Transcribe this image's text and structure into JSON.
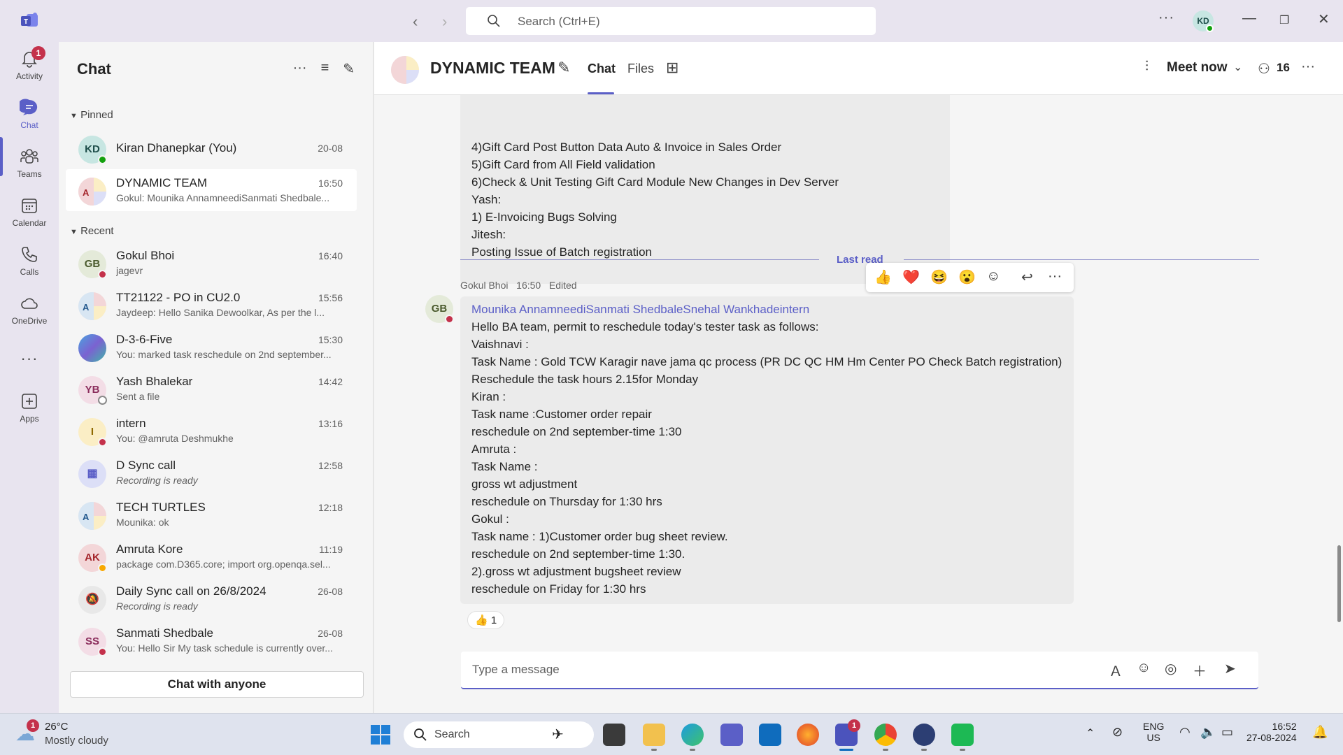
{
  "titlebar": {
    "search_placeholder": "Search (Ctrl+E)",
    "user_initials": "KD"
  },
  "rail": {
    "items": [
      {
        "label": "Activity",
        "badge": "1"
      },
      {
        "label": "Chat"
      },
      {
        "label": "Teams"
      },
      {
        "label": "Calendar"
      },
      {
        "label": "Calls"
      },
      {
        "label": "OneDrive"
      },
      {
        "label": "Apps"
      }
    ]
  },
  "chatlist": {
    "title": "Chat",
    "pinned_label": "Pinned",
    "recent_label": "Recent",
    "chat_with_anyone": "Chat with anyone",
    "pinned": [
      {
        "initials": "KD",
        "name": "Kiran Dhanepkar (You)",
        "time": "20-08",
        "preview": ""
      },
      {
        "initials": "A",
        "name": "DYNAMIC TEAM",
        "time": "16:50",
        "preview": "Gokul: Mounika AnnamneediSanmati Shedbale..."
      }
    ],
    "recent": [
      {
        "initials": "GB",
        "name": "Gokul Bhoi",
        "time": "16:40",
        "preview": "jagevr"
      },
      {
        "initials": "A",
        "name": "TT21122 - PO in CU2.0",
        "time": "15:56",
        "preview": "Jaydeep: Hello Sanika Dewoolkar,   As per the l..."
      },
      {
        "initials": "",
        "name": "D-3-6-Five",
        "time": "15:30",
        "preview": "You: marked task reschedule on 2nd september..."
      },
      {
        "initials": "YB",
        "name": "Yash Bhalekar",
        "time": "14:42",
        "preview": "Sent a file"
      },
      {
        "initials": "I",
        "name": "intern",
        "time": "13:16",
        "preview": "You: @amruta Deshmukhe"
      },
      {
        "initials": "",
        "name": "D Sync call",
        "time": "12:58",
        "preview": "Recording is ready"
      },
      {
        "initials": "A",
        "name": "TECH TURTLES",
        "time": "12:18",
        "preview": "Mounika: ok"
      },
      {
        "initials": "AK",
        "name": "Amruta Kore",
        "time": "11:19",
        "preview": "package com.D365.core; import org.openqa.sel..."
      },
      {
        "initials": "",
        "name": "Daily Sync call on 26/8/2024",
        "time": "26-08",
        "preview": "Recording is ready"
      },
      {
        "initials": "SS",
        "name": "Sanmati Shedbale",
        "time": "26-08",
        "preview": "You: Hello Sir My task schedule is currently over..."
      }
    ]
  },
  "conversation": {
    "title": "DYNAMIC TEAM",
    "tabs": [
      "Chat",
      "Files"
    ],
    "meet_now": "Meet now",
    "participants": "16",
    "prev_message_lines": [
      "4)Gift Card Post Button Data Auto & Invoice in Sales Order",
      "5)Gift Card from All Field validation",
      "6)Check & Unit Testing Gift Card Module New Changes in Dev Server",
      "Yash:",
      "1) E-Invoicing Bugs Solving",
      "Jitesh:",
      "Posting Issue of Batch registration"
    ],
    "last_read": "Last read",
    "message": {
      "sender": "Gokul Bhoi",
      "time": "16:50",
      "edited": "Edited",
      "initials": "GB",
      "mention_line": "Mounika AnnamneediSanmati ShedbaleSnehal Wankhadeintern",
      "lines": [
        "Hello BA team, permit to reschedule today's tester task as follows:",
        "Vaishnavi :",
        "Task Name : Gold TCW Karagir nave jama qc process (PR DC QC HM Hm Center PO Check Batch registration)",
        "Reschedule the task hours 2.15for Monday",
        "Kiran :",
        "Task name :Customer order repair",
        "reschedule on 2nd september-time 1:30",
        "Amruta :",
        "Task Name :",
        "gross wt adjustment",
        "reschedule on Thursday for 1:30 hrs",
        "Gokul :",
        "Task name : 1)Customer order bug sheet review.",
        "reschedule on 2nd september-time 1:30.",
        "2).gross wt adjustment  bugsheet review",
        "reschedule on Friday for 1:30 hrs"
      ],
      "reaction_count": "1"
    },
    "compose_placeholder": "Type a message"
  },
  "taskbar": {
    "weather_temp": "26°C",
    "weather_desc": "Mostly cloudy",
    "weather_badge": "1",
    "search_label": "Search",
    "teams_badge": "1",
    "lang": "ENG",
    "region": "US",
    "time": "16:52",
    "date": "27-08-2024"
  },
  "colors": {
    "accent": "#5b5fc7",
    "presence_available": "#13a10e",
    "presence_busy": "#c4314b",
    "presence_away": "#f8a800"
  }
}
